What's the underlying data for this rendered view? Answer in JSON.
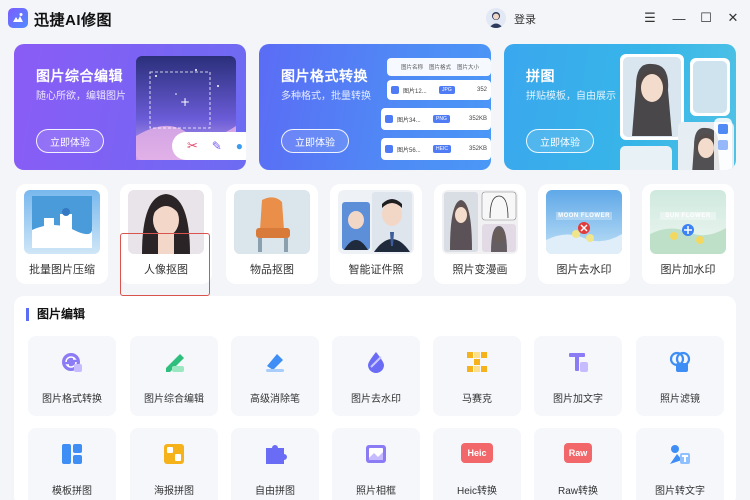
{
  "app": {
    "title": "迅捷AI修图",
    "login_label": "登录",
    "accent": "#5b6cf5"
  },
  "window_controls": [
    "menu-icon",
    "minimize-icon",
    "maximize-icon",
    "close-icon"
  ],
  "banners": [
    {
      "title": "图片综合编辑",
      "subtitle": "随心所欲，编辑图片",
      "button": "立即体验"
    },
    {
      "title": "图片格式转换",
      "subtitle": "多种格式，批量转换",
      "button": "立即体验",
      "table": {
        "headers": [
          "图片名称",
          "图片格式",
          "图片大小"
        ],
        "rows": [
          {
            "name": "图片12...",
            "format": "JPG",
            "size": "352"
          },
          {
            "name": "图片34...",
            "format": "PNG",
            "size": "352KB"
          },
          {
            "name": "图片56...",
            "format": "HEIC",
            "size": "352KB"
          }
        ]
      }
    },
    {
      "title": "拼图",
      "subtitle": "拼贴模板，自由展示",
      "button": "立即体验"
    }
  ],
  "tools": [
    {
      "label": "批量图片压缩"
    },
    {
      "label": "人像抠图"
    },
    {
      "label": "物品抠图"
    },
    {
      "label": "智能证件照"
    },
    {
      "label": "照片变漫画"
    },
    {
      "label": "图片去水印",
      "watermark_text": "MOON FLOWER"
    },
    {
      "label": "图片加水印",
      "watermark_text": "SUN FLOWER"
    }
  ],
  "edit_section": {
    "title": "图片编辑",
    "items": [
      {
        "label": "图片格式转换",
        "icon": "format-convert-icon"
      },
      {
        "label": "图片综合编辑",
        "icon": "edit-icon"
      },
      {
        "label": "高级消除笔",
        "icon": "eraser-icon"
      },
      {
        "label": "图片去水印",
        "icon": "drop-icon"
      },
      {
        "label": "马赛克",
        "icon": "mosaic-icon"
      },
      {
        "label": "图片加文字",
        "icon": "text-icon"
      },
      {
        "label": "照片滤镜",
        "icon": "filter-icon"
      },
      {
        "label": "模板拼图",
        "icon": "template-icon"
      },
      {
        "label": "海报拼图",
        "icon": "poster-icon"
      },
      {
        "label": "自由拼图",
        "icon": "puzzle-icon"
      },
      {
        "label": "照片相框",
        "icon": "frame-icon"
      },
      {
        "label": "Heic转换",
        "icon": "heic-icon",
        "badge": "Heic"
      },
      {
        "label": "Raw转换",
        "icon": "raw-icon",
        "badge": "Raw"
      },
      {
        "label": "图片转文字",
        "icon": "ocr-icon"
      }
    ]
  }
}
